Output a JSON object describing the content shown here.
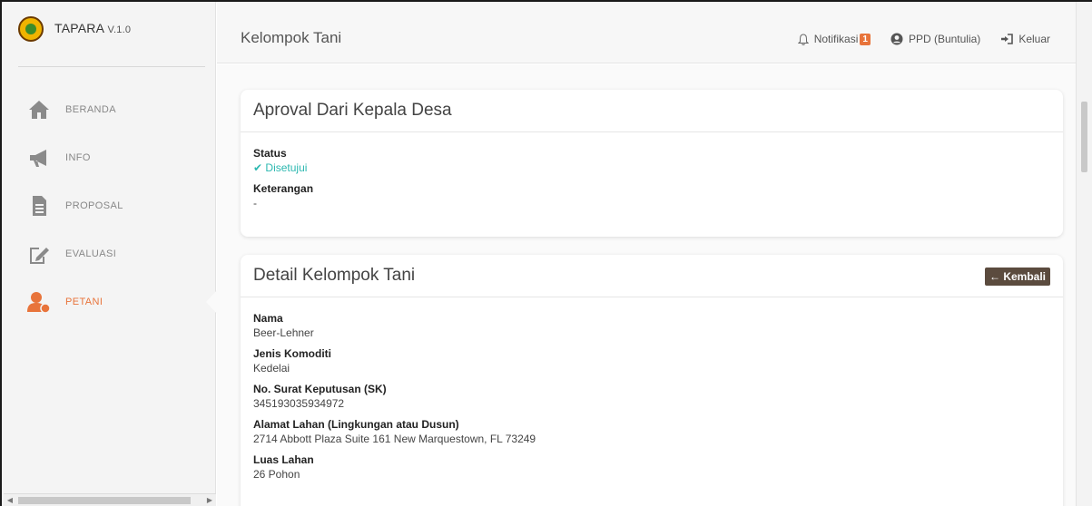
{
  "app": {
    "name": "TAPARA",
    "version": "V.1.0"
  },
  "sidebar": {
    "items": [
      {
        "label": "BERANDA",
        "icon": "home-icon"
      },
      {
        "label": "INFO",
        "icon": "megaphone-icon"
      },
      {
        "label": "PROPOSAL",
        "icon": "document-icon"
      },
      {
        "label": "EVALUASI",
        "icon": "edit-icon"
      },
      {
        "label": "PETANI",
        "icon": "farmer-icon",
        "active": true
      }
    ]
  },
  "header": {
    "title": "Kelompok Tani",
    "notifications_label": "Notifikasi",
    "notifications_count": "1",
    "user_label": "PPD (Buntulia)",
    "logout_label": "Keluar"
  },
  "approval_card": {
    "title": "Aproval Dari Kepala Desa",
    "status_label": "Status",
    "status_value": "Disetujui",
    "note_label": "Keterangan",
    "note_value": "-"
  },
  "detail_card": {
    "title": "Detail Kelompok Tani",
    "back_label": "← Kembali",
    "fields": [
      {
        "label": "Nama",
        "value": "Beer-Lehner"
      },
      {
        "label": "Jenis Komoditi",
        "value": "Kedelai"
      },
      {
        "label": "No. Surat Keputusan (SK)",
        "value": "345193035934972"
      },
      {
        "label": "Alamat Lahan (Lingkungan atau Dusun)",
        "value": "2714 Abbott Plaza Suite 161 New Marquestown, FL 73249"
      },
      {
        "label": "Luas Lahan",
        "value": "26 Pohon"
      }
    ]
  },
  "colors": {
    "accent": "#e8743b",
    "status_ok": "#2cb8b0",
    "back_button": "#5b4b3e"
  }
}
